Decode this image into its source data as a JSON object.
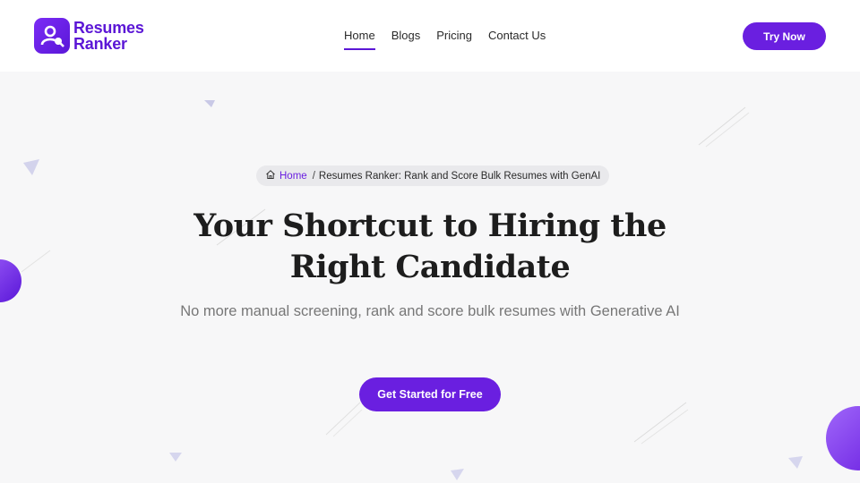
{
  "brand": {
    "name_line1": "Resumes",
    "name_line2": "Ranker",
    "accent_color": "#6a1fe0"
  },
  "nav": {
    "items": [
      {
        "label": "Home",
        "active": true
      },
      {
        "label": "Blogs",
        "active": false
      },
      {
        "label": "Pricing",
        "active": false
      },
      {
        "label": "Contact Us",
        "active": false
      }
    ],
    "cta_label": "Try Now"
  },
  "breadcrumb": {
    "icon": "home-icon",
    "home_label": "Home",
    "separator": "/",
    "current_label": "Resumes Ranker: Rank and Score Bulk Resumes with GenAI"
  },
  "hero": {
    "title_line1": "Your Shortcut to Hiring the",
    "title_line2": "Right Candidate",
    "subtitle": "No more manual screening, rank and score bulk resumes with Generative AI",
    "cta_label": "Get Started for Free"
  }
}
